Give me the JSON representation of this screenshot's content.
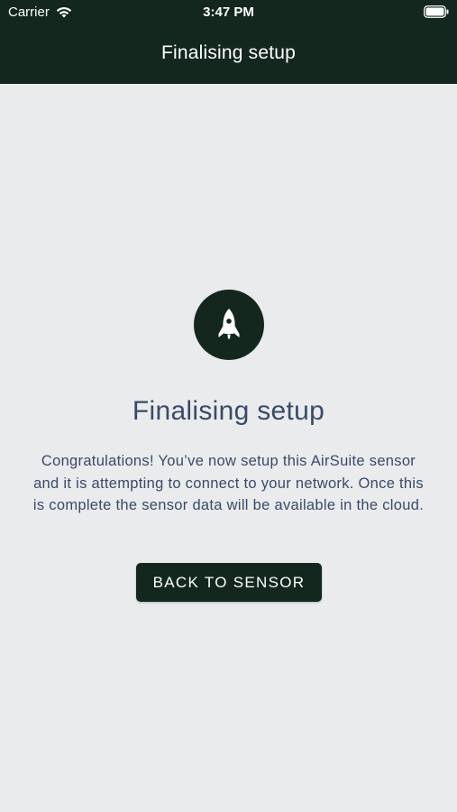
{
  "status_bar": {
    "carrier": "Carrier",
    "time": "3:47 PM",
    "wifi_icon": "wifi-icon",
    "battery_icon": "battery-icon"
  },
  "header": {
    "title": "Finalising setup",
    "background": "#13271f"
  },
  "main": {
    "icon": "rocket-icon",
    "title": "Finalising setup",
    "message": "Congratulations! You’ve now setup this AirSuite sensor and it is attempting to connect to your network. Once this is complete the sensor data will be available in the cloud.",
    "button_label": "BACK TO SENSOR"
  },
  "colors": {
    "accent": "#13271f",
    "background": "#e9ebed",
    "text": "#3b4a66"
  }
}
